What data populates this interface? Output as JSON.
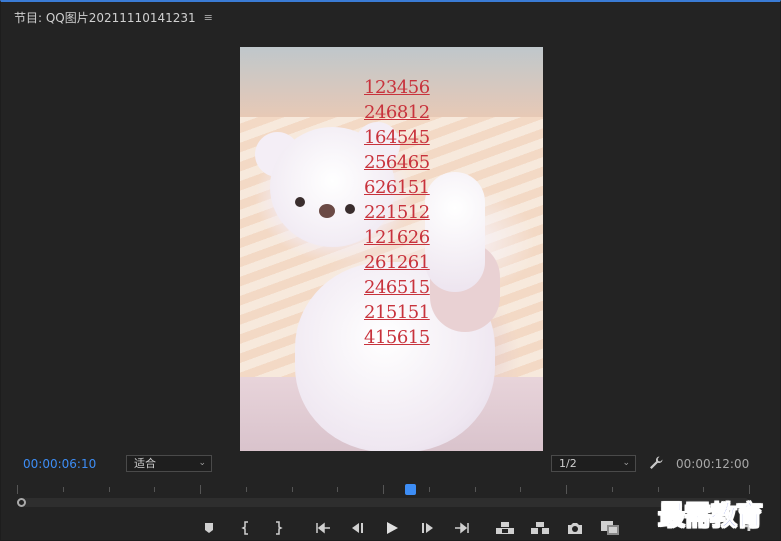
{
  "panel": {
    "title": "节目: QQ图片20211110141231",
    "menu_icon": "hamburger-icon",
    "menu_glyph": "≡"
  },
  "image_overlay": {
    "numbers": [
      "123456",
      "246812",
      "164545",
      "256465",
      "626151",
      "221512",
      "121626",
      "261261",
      "246515",
      "215151",
      "415615"
    ]
  },
  "timecode": {
    "current": "00:00:06:10",
    "duration": "00:00:12:00"
  },
  "zoom": {
    "selected": "适合"
  },
  "resolution": {
    "selected": "1/2"
  },
  "playback": {
    "position_fraction": 0.537
  },
  "controls": [
    {
      "name": "add-marker-button",
      "icon": "marker-icon"
    },
    {
      "name": "mark-in-button",
      "icon": "mark-in-icon"
    },
    {
      "name": "mark-out-button",
      "icon": "mark-out-icon"
    },
    {
      "name": "go-to-in-button",
      "icon": "go-to-in-icon"
    },
    {
      "name": "step-back-button",
      "icon": "step-back-icon"
    },
    {
      "name": "play-button",
      "icon": "play-icon"
    },
    {
      "name": "step-forward-button",
      "icon": "step-forward-icon"
    },
    {
      "name": "go-to-out-button",
      "icon": "go-to-out-icon"
    },
    {
      "name": "lift-button",
      "icon": "lift-icon"
    },
    {
      "name": "extract-button",
      "icon": "extract-icon"
    },
    {
      "name": "export-frame-button",
      "icon": "camera-icon"
    },
    {
      "name": "comparison-view-button",
      "icon": "compare-icon"
    }
  ],
  "watermark": "最需教育",
  "colors": {
    "accent": "#3d8df5",
    "overlay_text": "#c8323c",
    "watermark": "#1d35c8"
  }
}
